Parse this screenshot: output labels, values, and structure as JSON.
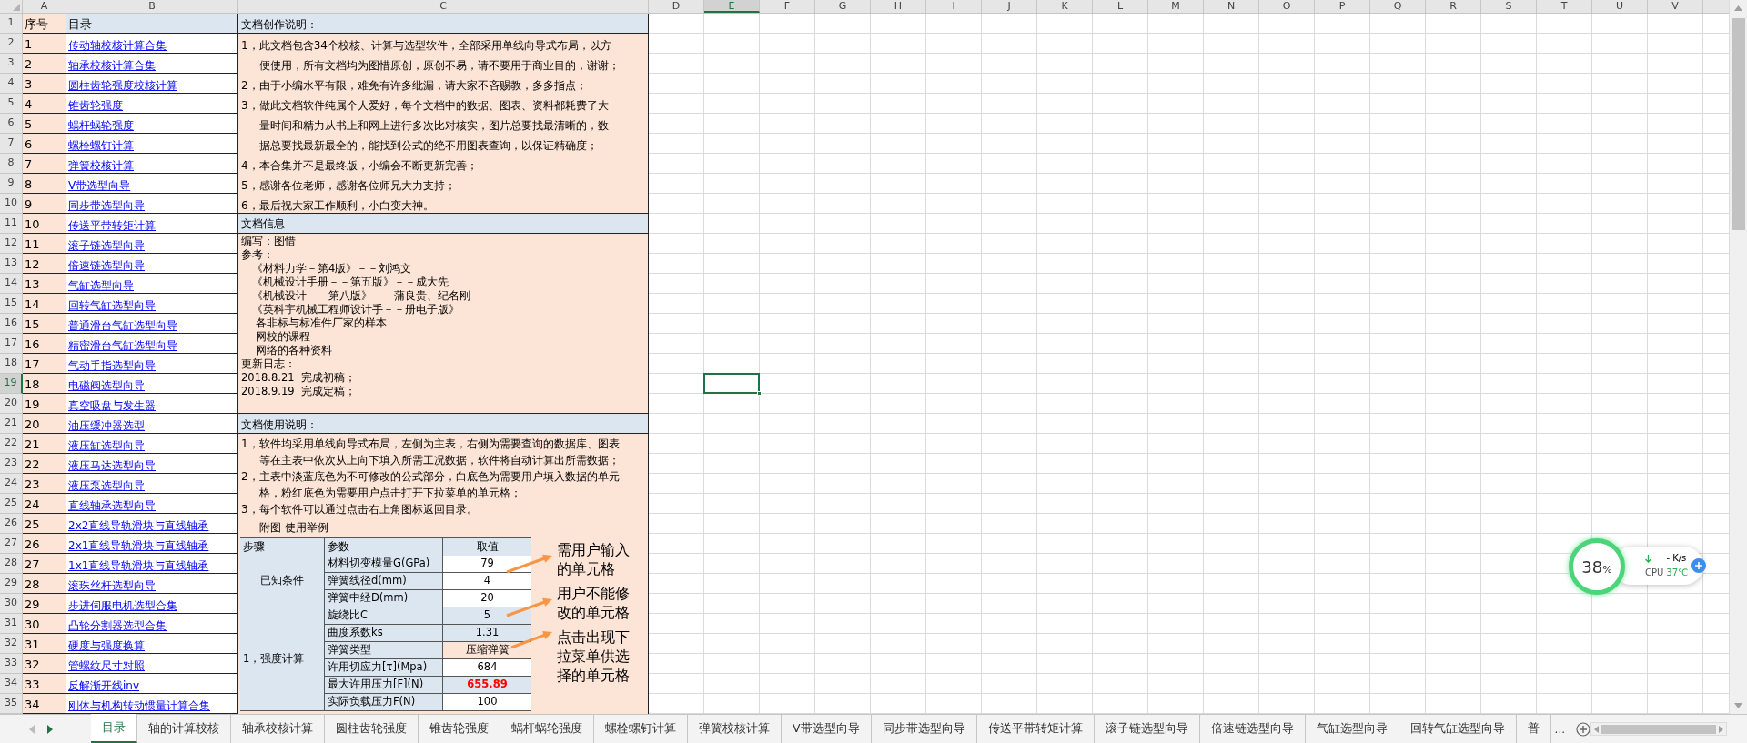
{
  "column_headers": [
    {
      "label": "A",
      "selected": false
    },
    {
      "label": "B",
      "selected": false
    },
    {
      "label": "C",
      "selected": false
    },
    {
      "label": "D",
      "selected": false
    },
    {
      "label": "E",
      "selected": true
    },
    {
      "label": "F",
      "selected": false
    },
    {
      "label": "G",
      "selected": false
    },
    {
      "label": "H",
      "selected": false
    },
    {
      "label": "I",
      "selected": false
    },
    {
      "label": "J",
      "selected": false
    },
    {
      "label": "K",
      "selected": false
    },
    {
      "label": "L",
      "selected": false
    },
    {
      "label": "M",
      "selected": false
    },
    {
      "label": "N",
      "selected": false
    },
    {
      "label": "O",
      "selected": false
    },
    {
      "label": "P",
      "selected": false
    },
    {
      "label": "Q",
      "selected": false
    },
    {
      "label": "R",
      "selected": false
    },
    {
      "label": "S",
      "selected": false
    },
    {
      "label": "T",
      "selected": false
    },
    {
      "label": "U",
      "selected": false
    },
    {
      "label": "V",
      "selected": false
    }
  ],
  "row_headers": [
    {
      "label": "1",
      "selected": false
    },
    {
      "label": "2",
      "selected": false
    },
    {
      "label": "3",
      "selected": false
    },
    {
      "label": "4",
      "selected": false
    },
    {
      "label": "5",
      "selected": false
    },
    {
      "label": "6",
      "selected": false
    },
    {
      "label": "7",
      "selected": false
    },
    {
      "label": "8",
      "selected": false
    },
    {
      "label": "9",
      "selected": false
    },
    {
      "label": "10",
      "selected": false
    },
    {
      "label": "11",
      "selected": false
    },
    {
      "label": "12",
      "selected": false
    },
    {
      "label": "13",
      "selected": false
    },
    {
      "label": "14",
      "selected": false
    },
    {
      "label": "15",
      "selected": false
    },
    {
      "label": "16",
      "selected": false
    },
    {
      "label": "17",
      "selected": false
    },
    {
      "label": "18",
      "selected": false
    },
    {
      "label": "19",
      "selected": true
    },
    {
      "label": "20",
      "selected": false
    },
    {
      "label": "21",
      "selected": false
    },
    {
      "label": "22",
      "selected": false
    },
    {
      "label": "23",
      "selected": false
    },
    {
      "label": "24",
      "selected": false
    },
    {
      "label": "25",
      "selected": false
    },
    {
      "label": "26",
      "selected": false
    },
    {
      "label": "27",
      "selected": false
    },
    {
      "label": "28",
      "selected": false
    },
    {
      "label": "29",
      "selected": false
    },
    {
      "label": "30",
      "selected": false
    },
    {
      "label": "31",
      "selected": false
    },
    {
      "label": "32",
      "selected": false
    },
    {
      "label": "33",
      "selected": false
    },
    {
      "label": "34",
      "selected": false
    },
    {
      "label": "35",
      "selected": false
    }
  ],
  "catalog_header": {
    "number": "序号",
    "title": "目录"
  },
  "catalog": [
    {
      "number": "1",
      "title": "传动轴校核计算合集"
    },
    {
      "number": "2",
      "title": "轴承校核计算合集"
    },
    {
      "number": "3",
      "title": "圆柱齿轮强度校核计算"
    },
    {
      "number": "4",
      "title": "锥齿轮强度"
    },
    {
      "number": "5",
      "title": "蜗杆蜗轮强度"
    },
    {
      "number": "6",
      "title": "螺栓螺钉计算"
    },
    {
      "number": "7",
      "title": "弹簧校核计算"
    },
    {
      "number": "8",
      "title": "V带选型向导"
    },
    {
      "number": "9",
      "title": "同步带选型向导"
    },
    {
      "number": "10",
      "title": "传送平带转矩计算"
    },
    {
      "number": "11",
      "title": "滚子链选型向导"
    },
    {
      "number": "12",
      "title": "倍速链选型向导"
    },
    {
      "number": "13",
      "title": "气缸选型向导"
    },
    {
      "number": "14",
      "title": "回转气缸选型向导"
    },
    {
      "number": "15",
      "title": "普通滑台气缸选型向导"
    },
    {
      "number": "16",
      "title": "精密滑台气缸选型向导"
    },
    {
      "number": "17",
      "title": "气动手指选型向导"
    },
    {
      "number": "18",
      "title": "电磁阀选型向导"
    },
    {
      "number": "19",
      "title": "真空吸盘与发生器"
    },
    {
      "number": "20",
      "title": "油压缓冲器选型"
    },
    {
      "number": "21",
      "title": "液压缸选型向导"
    },
    {
      "number": "22",
      "title": "液压马达选型向导"
    },
    {
      "number": "23",
      "title": "液压泵选型向导"
    },
    {
      "number": "24",
      "title": "直线轴承选型向导"
    },
    {
      "number": "25",
      "title": "2x2直线导轨滑块与直线轴承"
    },
    {
      "number": "26",
      "title": "2x1直线导轨滑块与直线轴承"
    },
    {
      "number": "27",
      "title": "1x1直线导轨滑块与直线轴承"
    },
    {
      "number": "28",
      "title": "滚珠丝杆选型向导"
    },
    {
      "number": "29",
      "title": "步进伺服电机选型合集"
    },
    {
      "number": "30",
      "title": "凸轮分割器选型合集"
    },
    {
      "number": "31",
      "title": "硬度与强度换算"
    },
    {
      "number": "32",
      "title": "管螺纹尺寸对照"
    },
    {
      "number": "33",
      "title": "反解渐开线inv"
    },
    {
      "number": "34",
      "title": "刚体与机构转动惯量计算合集"
    }
  ],
  "creation_notes": {
    "title": "文档创作说明：",
    "items": [
      {
        "lines": [
          "1，此文档包含34个校核、计算与选型软件，全部采用单线向导式布局，以方",
          "便使用，所有文档均为图惜原创，原创不易，请不要用于商业目的，谢谢；"
        ]
      },
      {
        "lines": [
          "2，由于小编水平有限，难免有许多纰漏，请大家不吝赐教，多多指点；"
        ]
      },
      {
        "lines": [
          "3，做此文档软件纯属个人爱好，每个文档中的数据、图表、资料都耗费了大",
          "量时间和精力从书上和网上进行多次比对核实，图片总要找最清晰的，数",
          "据总要找最新最全的，能找到公式的绝不用图表查询，以保证精确度；"
        ]
      },
      {
        "lines": [
          "4，本合集并不是最终版，小编会不断更新完善；"
        ]
      },
      {
        "lines": [
          "5，感谢各位老师，感谢各位师兄大力支持；"
        ]
      },
      {
        "lines": [
          "6，最后祝大家工作顺利，小白变大神。"
        ]
      }
    ]
  },
  "doc_info": {
    "title": "文档信息",
    "lines": [
      {
        "kind": "plain",
        "text": "编写：图惜"
      },
      {
        "kind": "plain",
        "text": "参考："
      },
      {
        "kind": "indent",
        "text": "《材料力学－第4版》－－刘鸿文"
      },
      {
        "kind": "indent",
        "text": "《机械设计手册－－第五版》－－成大先"
      },
      {
        "kind": "indent",
        "text": "《机械设计－－第八版》－－蒲良贵、纪名刚"
      },
      {
        "kind": "indent",
        "text": "《英科宇机械工程师设计手－－册电子版》"
      },
      {
        "kind": "indent",
        "text": " 各非标与标准件厂家的样本"
      },
      {
        "kind": "indent",
        "text": " 网校的课程"
      },
      {
        "kind": "indent",
        "text": " 网络的各种资料"
      },
      {
        "kind": "plain",
        "text": "更新日志："
      },
      {
        "kind": "plain",
        "text": "2018.8.21  完成初稿；"
      },
      {
        "kind": "plain",
        "text": "2018.9.19  完成定稿；"
      }
    ]
  },
  "usage_notes": {
    "title": "文档使用说明：",
    "items": [
      {
        "lines": [
          "1，软件均采用单线向导式布局，左侧为主表，右侧为需要查询的数据库、图表",
          "等在主表中依次从上向下填入所需工况数据，软件将自动计算出所需数据；"
        ]
      },
      {
        "lines": [
          "2，主表中淡蓝底色为不可修改的公式部分，白底色为需要用户填入数据的单元",
          "格，粉红底色为需要用户点击打开下拉菜单的单元格；"
        ]
      },
      {
        "lines": [
          "3，每个软件可以通过点击右上角图标返回目录。"
        ]
      }
    ],
    "figure_caption": "附图 使用举例"
  },
  "example_table": {
    "columns": [
      "步骤",
      "参数",
      "取值"
    ],
    "groups": [
      {
        "step": "已知条件",
        "rows": [
          {
            "param": "材料切变模量G(GPa)",
            "value": "79",
            "kind": "input"
          },
          {
            "param": "弹簧线径d(mm)",
            "value": "4",
            "kind": "input"
          },
          {
            "param": "弹簧中经D(mm)",
            "value": "20",
            "kind": "input"
          }
        ]
      },
      {
        "step": "1，强度计算",
        "rows": [
          {
            "param": "旋绕比C",
            "value": "5",
            "kind": "formula"
          },
          {
            "param": "曲度系数ks",
            "value": "1.31",
            "kind": "formula"
          },
          {
            "param": "弹簧类型",
            "value": "压缩弹簧",
            "kind": "dropdown"
          },
          {
            "param": "许用切应力[τ](Mpa)",
            "value": "684",
            "kind": "input"
          },
          {
            "param": "最大许用压力[F](N)",
            "value": "655.89",
            "kind": "result"
          },
          {
            "param": "实际负载压力F(N)",
            "value": "100",
            "kind": "input"
          }
        ]
      }
    ]
  },
  "callouts": [
    {
      "lines": [
        "需用户输入",
        "的单元格"
      ]
    },
    {
      "lines": [
        "用户不能修",
        "改的单元格"
      ]
    },
    {
      "lines": [
        "点击出现下",
        "拉菜单供选",
        "择的单元格"
      ]
    }
  ],
  "sheet_tabs": [
    {
      "label": "目录",
      "selected": true
    },
    {
      "label": "轴的计算校核",
      "selected": false
    },
    {
      "label": "轴承校核计算",
      "selected": false
    },
    {
      "label": "圆柱齿轮强度",
      "selected": false
    },
    {
      "label": "锥齿轮强度",
      "selected": false
    },
    {
      "label": "蜗杆蜗轮强度",
      "selected": false
    },
    {
      "label": "螺栓螺钉计算",
      "selected": false
    },
    {
      "label": "弹簧校核计算",
      "selected": false
    },
    {
      "label": "V带选型向导",
      "selected": false
    },
    {
      "label": "同步带选型向导",
      "selected": false
    },
    {
      "label": "传送平带转矩计算",
      "selected": false
    },
    {
      "label": "滚子链选型向导",
      "selected": false
    },
    {
      "label": "倍速链选型向导",
      "selected": false
    },
    {
      "label": "气缸选型向导",
      "selected": false
    },
    {
      "label": "回转气缸选型向导",
      "selected": false
    },
    {
      "label": "普",
      "selected": false
    }
  ],
  "more_tabs": "...",
  "cpu_widget": {
    "percent": "38",
    "unit": "%",
    "speed": "- K/s",
    "label": "CPU",
    "temperature": "37℃"
  }
}
